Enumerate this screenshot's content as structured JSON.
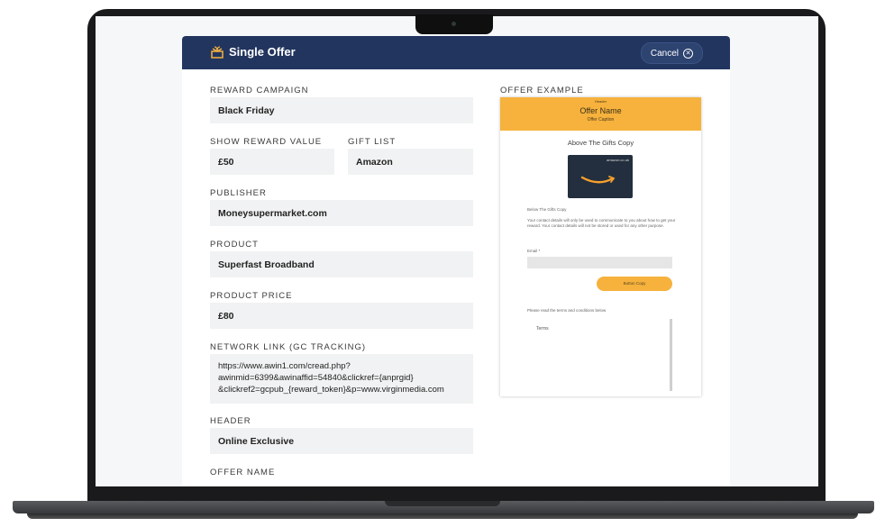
{
  "modal": {
    "title": "Single Offer",
    "cancel_label": "Cancel"
  },
  "form": {
    "reward_campaign": {
      "label": "REWARD CAMPAIGN",
      "value": "Black Friday"
    },
    "show_reward_value": {
      "label": "SHOW REWARD VALUE",
      "value": "£50"
    },
    "gift_list": {
      "label": "GIFT LIST",
      "value": "Amazon"
    },
    "publisher": {
      "label": "PUBLISHER",
      "value": "Moneysupermarket.com"
    },
    "product": {
      "label": "PRODUCT",
      "value": "Superfast Broadband"
    },
    "product_price": {
      "label": "PRODUCT PRICE",
      "value": "£80"
    },
    "network_link": {
      "label": "NETWORK LINK (GC TRACKING)",
      "lines": [
        "https://www.awin1.com/cread.php?",
        "awinmid=6399&awinaffid=54840&clickref={anprgid}",
        "&clickref2=gcpub_{reward_token}&p=www.virginmedia.com"
      ]
    },
    "header": {
      "label": "HEADER",
      "value": "Online Exclusive"
    },
    "offer_name": {
      "label": "OFFER NAME"
    }
  },
  "preview": {
    "label": "OFFER EXAMPLE",
    "header_small": "Header",
    "offer_name": "Offer Name",
    "offer_caption": "Offer Caption",
    "above_copy": "Above The Gifts Copy",
    "giftcard_brand": "amazon.co.uk",
    "below_copy": "Below The Gifts Copy",
    "contact_note": "Your contact details will only be used to communicate to you about how to get your reward. Your contact details will not be stored or used for any other purpose.",
    "email_label": "Email *",
    "button_label": "Button Copy",
    "terms_note": "Please read the terms and conditions below",
    "terms_label": "Terms"
  },
  "colors": {
    "header_navy": "#22355f",
    "accent_orange": "#f6b23d",
    "field_bg": "#f1f2f3"
  }
}
